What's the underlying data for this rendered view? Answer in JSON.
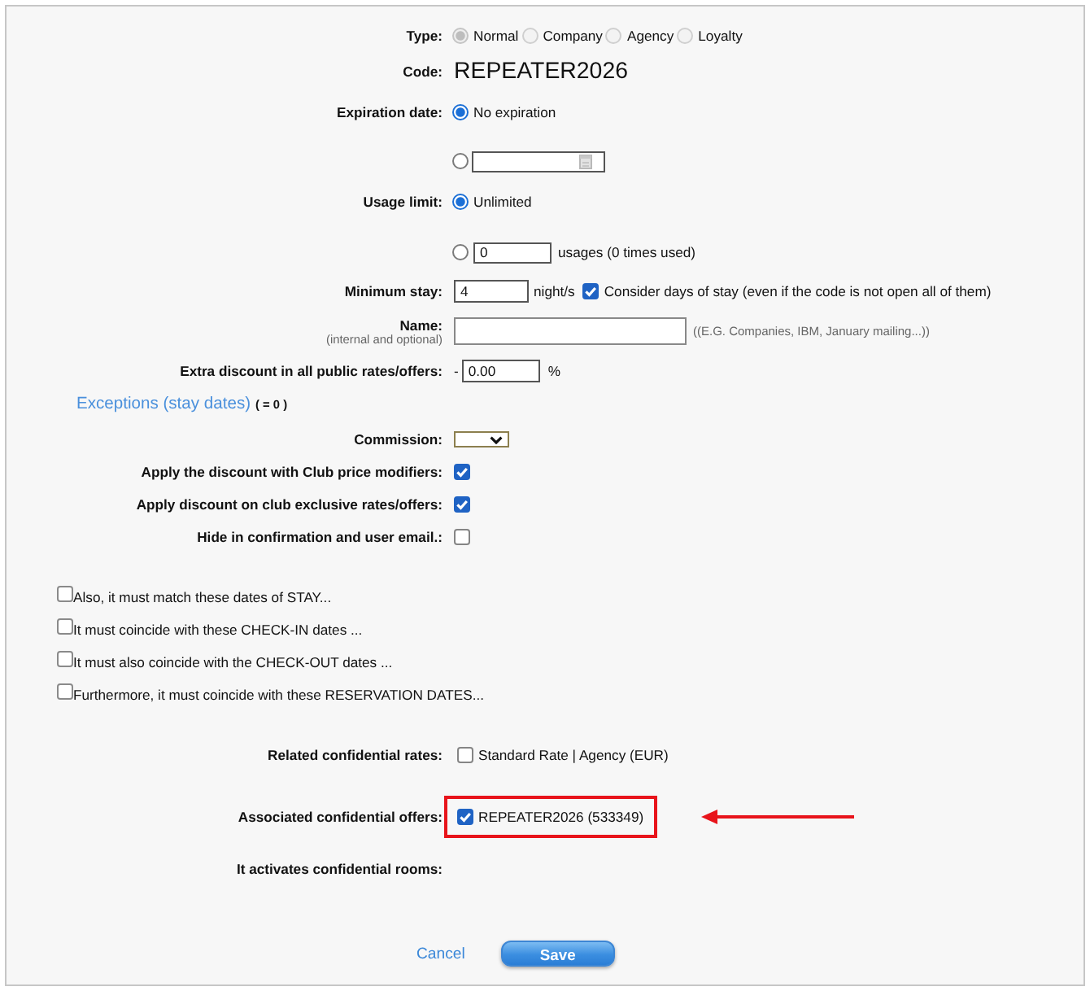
{
  "type": {
    "label": "Type:",
    "disabled": true,
    "options": [
      {
        "label": "Normal",
        "selected": true
      },
      {
        "label": "Company",
        "selected": false
      },
      {
        "label": "Agency",
        "selected": false
      },
      {
        "label": "Loyalty",
        "selected": false
      }
    ]
  },
  "code": {
    "label": "Code:",
    "value": "REPEATER2026"
  },
  "expiration_date": {
    "label": "Expiration date:",
    "options": [
      {
        "kind": "plain",
        "label": "No expiration",
        "selected": true
      },
      {
        "kind": "date",
        "selected": false
      }
    ]
  },
  "usage_limit": {
    "label": "Usage limit:",
    "options": [
      {
        "kind": "plain",
        "label": "Unlimited",
        "selected": true
      },
      {
        "kind": "count",
        "value": "0",
        "suffix": "usages (0 times used)",
        "selected": false
      }
    ]
  },
  "minimum_stay": {
    "label": "Minimum stay:",
    "value": "4",
    "unit": "night/s",
    "consider_days": {
      "label": "Consider days of stay (even if the code is not open all of them)",
      "checked": true
    }
  },
  "name": {
    "label": "Name:",
    "sublabel": "(internal and optional)",
    "note": "((E.G. Companies, IBM, January mailing...))"
  },
  "extra_discount": {
    "label": "Extra discount in all public rates/offers:",
    "sign": "-",
    "value": "0.00",
    "unit": "%"
  },
  "exceptions": {
    "link": "Exceptions (stay dates)",
    "count": "( = 0 )"
  },
  "commission": {
    "label": "Commission:"
  },
  "settings": [
    {
      "label": "Apply the discount with Club price modifiers:",
      "checked": true
    },
    {
      "label": "Apply discount on club exclusive rates/offers:",
      "checked": true
    },
    {
      "label": "Hide in confirmation and user email.:",
      "checked": false
    }
  ],
  "date_conditions": [
    {
      "label": "Also, it must match these dates of STAY...",
      "checked": false
    },
    {
      "label": "It must coincide with these CHECK-IN dates ...",
      "checked": false
    },
    {
      "label": "It must also coincide with the CHECK-OUT dates ...",
      "checked": false
    },
    {
      "label": "Furthermore, it must coincide with these RESERVATION DATES...",
      "checked": false
    }
  ],
  "confidential_rates": {
    "label": "Related confidential rates:",
    "items": [
      {
        "label": "Standard Rate | Agency (EUR)",
        "checked": false
      }
    ]
  },
  "confidential_offers": {
    "label": "Associated confidential offers:",
    "items": [
      {
        "label": "REPEATER2026 (533349)",
        "checked": true,
        "highlighted": true
      }
    ]
  },
  "confidential_rooms": {
    "label": "It activates confidential rooms:"
  },
  "actions": {
    "cancel": "Cancel",
    "save": "Save"
  }
}
